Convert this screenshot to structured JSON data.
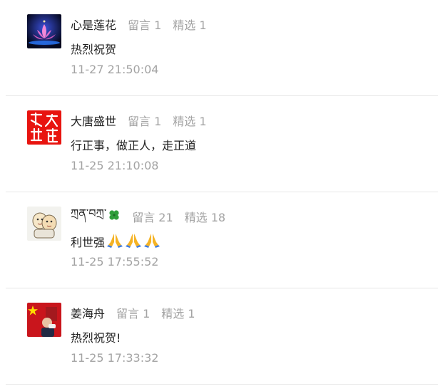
{
  "comments": [
    {
      "nickname": "心是莲花",
      "reply_label": "留言 1",
      "featured_label": "精选 1",
      "content": "热烈祝贺",
      "time": "11-27 21:50:04",
      "avatar": "lotus-avatar"
    },
    {
      "nickname": "大唐盛世",
      "reply_label": "留言 1",
      "featured_label": "精选 1",
      "content": "行正事，做正人，走正道",
      "time": "11-25 21:10:08",
      "avatar": "calligraphy-avatar"
    },
    {
      "nickname": "ཀྲན་བཀྲ་",
      "reply_label": "留言 21",
      "featured_label": "精选 18",
      "content": "利世强",
      "content_icons": [
        "folded-hands-icon",
        "folded-hands-icon",
        "folded-hands-icon"
      ],
      "nickname_icon": "four-leaf-clover-icon",
      "time": "11-25 17:55:52",
      "avatar": "cartoon-avatar"
    },
    {
      "nickname": "姜海舟",
      "reply_label": "留言 1",
      "featured_label": "精选 1",
      "content": "热烈祝贺!",
      "time": "11-25 17:33:32",
      "avatar": "flag-avatar"
    }
  ],
  "colors": {
    "name": "#222222",
    "meta": "#a3a3a3",
    "divider": "#e6e6e6"
  }
}
